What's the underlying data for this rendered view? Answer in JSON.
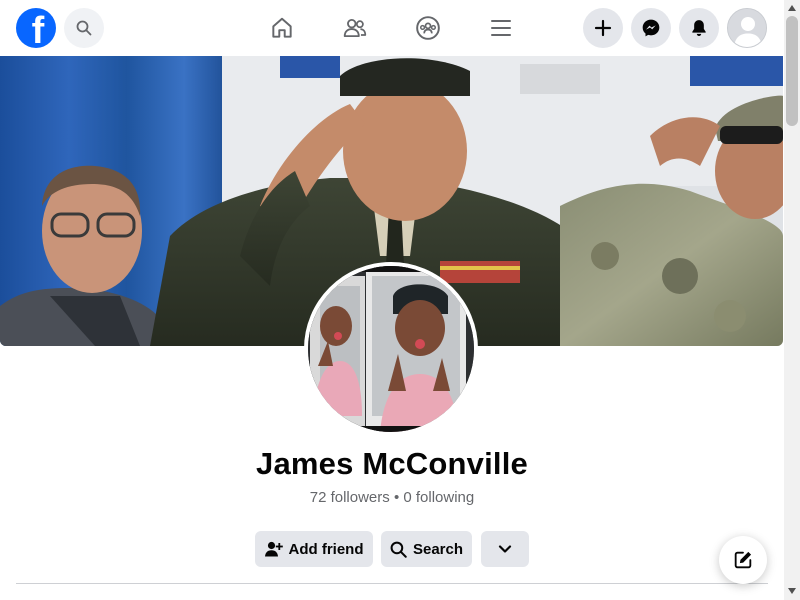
{
  "topbar": {
    "logo_letter": "f",
    "icons": {
      "search": "search-icon",
      "home": "home-icon",
      "friends": "friends-icon",
      "groups": "groups-icon",
      "menu": "menu-icon",
      "create": "plus-icon",
      "messenger": "messenger-icon",
      "notifications": "bell-icon",
      "account": "avatar-icon"
    }
  },
  "profile": {
    "name": "James McConville",
    "stats": "72 followers • 0 following"
  },
  "actions": {
    "add_friend": "Add friend",
    "search": "Search"
  },
  "colors": {
    "brand": "#0866ff",
    "button_bg": "#e4e6eb",
    "text_primary": "#050505",
    "text_secondary": "#65676b"
  }
}
